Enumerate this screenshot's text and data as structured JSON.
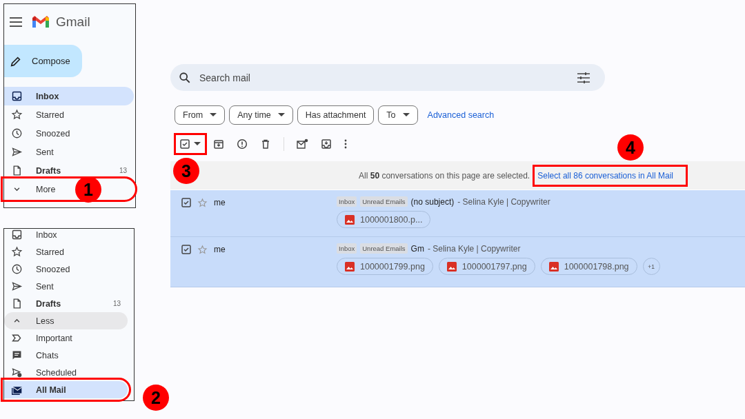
{
  "panel_1": {
    "app_title": "Gmail",
    "compose": "Compose",
    "nav": [
      {
        "label": "Inbox",
        "kind": "inbox",
        "bold": true,
        "selected": true,
        "hovered": false,
        "highlighted": false
      },
      {
        "label": "Starred",
        "kind": "starred",
        "bold": false,
        "selected": false,
        "hovered": false,
        "highlighted": false
      },
      {
        "label": "Snoozed",
        "kind": "snoozed",
        "bold": false,
        "selected": false,
        "hovered": false,
        "highlighted": false
      },
      {
        "label": "Sent",
        "kind": "sent",
        "bold": false,
        "selected": false,
        "hovered": false,
        "highlighted": false
      },
      {
        "label": "Drafts",
        "kind": "drafts",
        "count": "13",
        "bold": true,
        "selected": false,
        "hovered": false,
        "highlighted": false
      },
      {
        "label": "More",
        "kind": "more",
        "bold": false,
        "selected": false,
        "hovered": false,
        "highlighted": true
      }
    ]
  },
  "panel_2": {
    "nav": [
      {
        "label": "Inbox",
        "kind": "inbox",
        "bold": false,
        "selected": false,
        "hovered": false,
        "highlighted": false
      },
      {
        "label": "Starred",
        "kind": "starred",
        "bold": false,
        "selected": false,
        "hovered": false,
        "highlighted": false
      },
      {
        "label": "Snoozed",
        "kind": "snoozed",
        "bold": false,
        "selected": false,
        "hovered": false,
        "highlighted": false
      },
      {
        "label": "Sent",
        "kind": "sent",
        "bold": false,
        "selected": false,
        "hovered": false,
        "highlighted": false
      },
      {
        "label": "Drafts",
        "kind": "drafts",
        "count": "13",
        "bold": true,
        "selected": false,
        "hovered": false,
        "highlighted": false
      },
      {
        "label": "Less",
        "kind": "less",
        "bold": false,
        "selected": false,
        "hovered": true,
        "highlighted": false
      },
      {
        "label": "Important",
        "kind": "important",
        "bold": false,
        "selected": false,
        "hovered": false,
        "highlighted": false
      },
      {
        "label": "Chats",
        "kind": "chats",
        "bold": false,
        "selected": false,
        "hovered": false,
        "highlighted": false
      },
      {
        "label": "Scheduled",
        "kind": "scheduled",
        "bold": false,
        "selected": false,
        "hovered": false,
        "highlighted": false
      },
      {
        "label": "All Mail",
        "kind": "allmail",
        "bold": true,
        "selected": true,
        "hovered": false,
        "highlighted": true
      }
    ]
  },
  "main": {
    "search": {
      "placeholder": "Search mail"
    },
    "filters": [
      {
        "label": "From",
        "dropdown": true
      },
      {
        "label": "Any time",
        "dropdown": true
      },
      {
        "label": "Has attachment",
        "dropdown": false
      },
      {
        "label": "To",
        "dropdown": true
      }
    ],
    "advanced_search": "Advanced search",
    "select_all": {
      "checked": true,
      "highlighted": true
    },
    "banner": {
      "text": "All **50** conversations on this page are selected.",
      "link": "Select all 86 conversations in All Mail",
      "highlighted": true
    },
    "messages": [
      {
        "checked": true,
        "starred": false,
        "sender": "me",
        "labels": [
          "Inbox",
          "Unread Emails"
        ],
        "subject": "(no subject)",
        "snippet": "- Selina Kyle | Copywriter",
        "attachments": [
          "1000001800.p..."
        ]
      },
      {
        "checked": true,
        "starred": false,
        "sender": "me",
        "labels": [
          "Inbox",
          "Unread Emails"
        ],
        "subject": "Gm",
        "snippet": "- Selina Kyle | Copywriter",
        "attachments": [
          "1000001799.png",
          "1000001797.png",
          "1000001798.png"
        ],
        "more": "+1"
      }
    ]
  },
  "callouts": [
    {
      "number": "1"
    },
    {
      "number": "2"
    },
    {
      "number": "3"
    },
    {
      "number": "4"
    }
  ]
}
